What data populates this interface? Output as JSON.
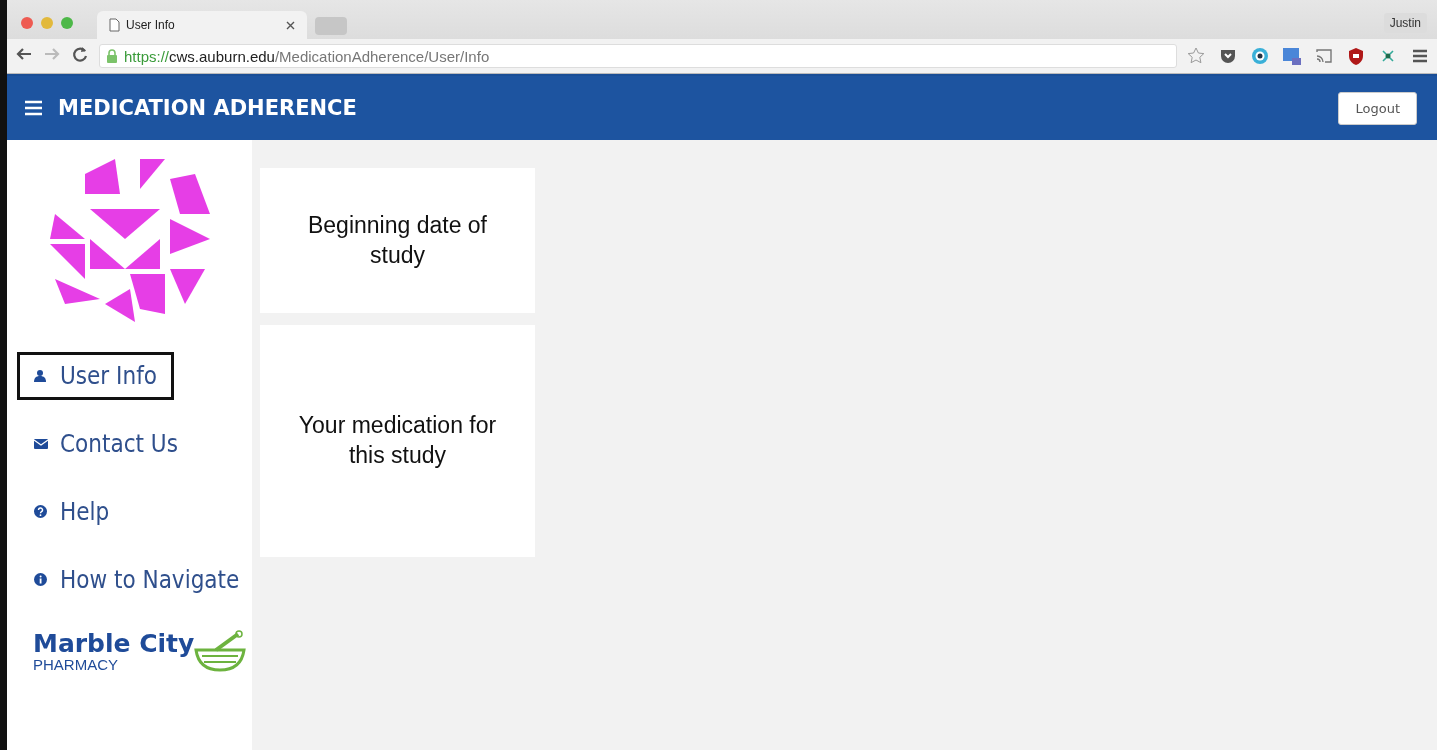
{
  "browser": {
    "tab": {
      "title": "User Info",
      "selected": true
    },
    "profile": "Justin",
    "url": {
      "scheme": "https://",
      "host": "cws.auburn.edu",
      "path": "/MedicationAdherence/User/Info"
    }
  },
  "header": {
    "title": "MEDICATION ADHERENCE",
    "logout": "Logout"
  },
  "sidebar": {
    "items": [
      {
        "label": "User Info",
        "kind": "user",
        "selected": true
      },
      {
        "label": "Contact Us",
        "kind": "mail",
        "selected": false
      },
      {
        "label": "Help",
        "kind": "help",
        "selected": false
      },
      {
        "label": "How to Navigate",
        "kind": "info",
        "selected": false
      }
    ],
    "pharmacy": {
      "name": "Marble City",
      "subtitle": "PHARMACY"
    }
  },
  "cards": [
    {
      "text": "Beginning date of study"
    },
    {
      "text": "Your medication for this study"
    }
  ]
}
